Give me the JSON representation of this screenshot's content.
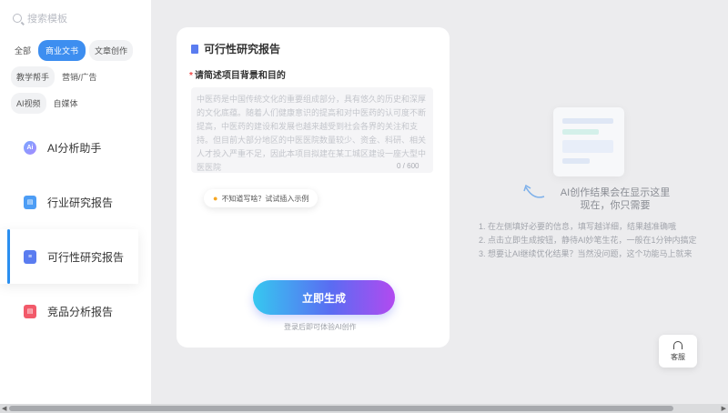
{
  "sidebar": {
    "search_placeholder": "搜索模板",
    "chips_row1": [
      "全部",
      "商业文书",
      "文章创作"
    ],
    "chips_row2": [
      "教学帮手",
      "营销/广告"
    ],
    "chips_row3": [
      "AI视频",
      "自媒体"
    ],
    "nav": [
      {
        "label": "AI分析助手",
        "icon": "ai-icon"
      },
      {
        "label": "行业研究报告",
        "icon": "report-icon"
      },
      {
        "label": "可行性研究报告",
        "icon": "document-icon"
      },
      {
        "label": "竞品分析报告",
        "icon": "compare-icon"
      }
    ]
  },
  "form": {
    "title": "可行性研究报告",
    "required_mark": "*",
    "field_label": "请简述项目背景和目的",
    "field_placeholder": "中医药是中国传统文化的重要组成部分，具有悠久的历史和深厚的文化底蕴。随着人们健康意识的提高和对中医药的认可度不断提高，中医药的建设和发展也越来越受到社会各界的关注和支持。但目前大部分地区的中医医院数量较少、资金、科研、相关人才投入严重不足，因此本项目拟建在某工城区建设一座大型中医医院",
    "counter": "0 / 600",
    "hint_button": "不知道写啥？试试插入示例",
    "generate_button": "立即生成",
    "login_note": "登录后即可体验AI创作"
  },
  "preview": {
    "title_line1": "AI创作结果会在显示这里",
    "title_line2": "现在，你只需要",
    "steps": [
      "1. 在左侧填好必要的信息，填写越详细，结果越准确哦",
      "2. 点击立即生成按钮，静待AI妙笔生花，一般在1分钟内搞定",
      "3. 想要让AI继续优化结果？当然没问题，这个功能马上就来"
    ],
    "service_label": "客服"
  },
  "colors": {
    "accent": "#3d8ef0",
    "gradient_start": "#36c8f0",
    "gradient_end": "#b24af0"
  }
}
